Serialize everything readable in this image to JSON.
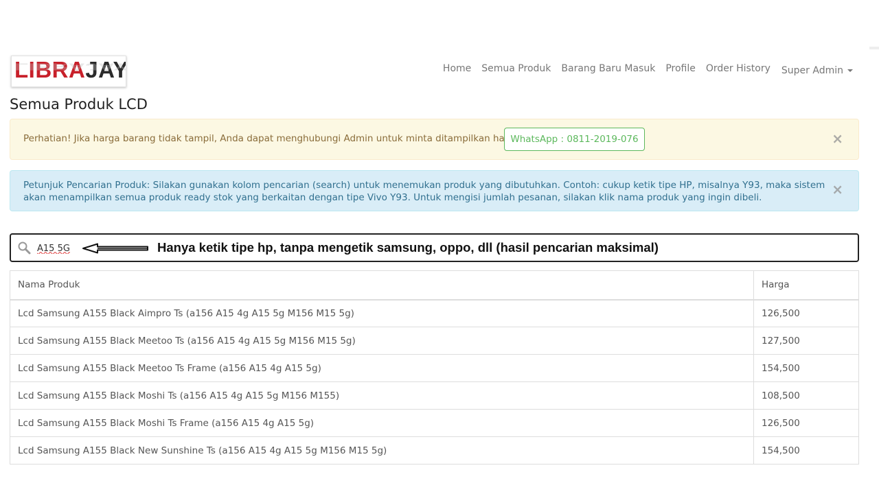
{
  "brand": {
    "name_part1": "LIBRA",
    "name_part2": "JAYA"
  },
  "nav": {
    "items": [
      {
        "label": "Home"
      },
      {
        "label": "Semua Produk"
      },
      {
        "label": "Barang Baru Masuk"
      },
      {
        "label": "Profile"
      },
      {
        "label": "Order History"
      }
    ],
    "user_menu": {
      "label": "Super Admin"
    }
  },
  "page": {
    "title": "Semua Produk LCD"
  },
  "alerts": {
    "warning": {
      "text": "Perhatian! Jika harga barang tidak tampil, Anda dapat menghubungi Admin untuk minta ditampilkan harga.",
      "button_label": "WhatsApp : 0811-2019-076",
      "close": "×"
    },
    "info": {
      "text": "Petunjuk Pencarian Produk: Silakan gunakan kolom pencarian (search) untuk menemukan produk yang dibutuhkan. Contoh: cukup ketik tipe HP, misalnya Y93, maka sistem akan menampilkan semua produk ready stok yang berkaitan dengan tipe Vivo Y93. Untuk mengisi jumlah pesanan, silakan klik nama produk yang ingin dibeli.",
      "close": "×"
    }
  },
  "search": {
    "value": "A15 5G",
    "icon": "search-icon",
    "hint": "Hanya ketik tipe hp, tanpa mengetik samsung, oppo, dll (hasil pencarian maksimal)"
  },
  "table": {
    "columns": [
      "Nama Produk",
      "Harga"
    ],
    "rows": [
      {
        "name": "Lcd Samsung A155 Black Aimpro Ts (a156 A15 4g A15 5g M156 M15 5g)",
        "price": "126,500"
      },
      {
        "name": "Lcd Samsung A155 Black Meetoo Ts (a156 A15 4g A15 5g M156 M15 5g)",
        "price": "127,500"
      },
      {
        "name": "Lcd Samsung A155 Black Meetoo Ts Frame (a156 A15 4g A15 5g)",
        "price": "154,500"
      },
      {
        "name": "Lcd Samsung A155 Black Moshi Ts (a156 A15 4g A15 5g M156 M155)",
        "price": "108,500"
      },
      {
        "name": "Lcd Samsung A155 Black Moshi Ts Frame (a156 A15 4g A15 5g)",
        "price": "126,500"
      },
      {
        "name": "Lcd Samsung A155 Black New Sunshine Ts (a156 A15 4g A15 5g M156 M15 5g)",
        "price": "154,500"
      }
    ]
  }
}
